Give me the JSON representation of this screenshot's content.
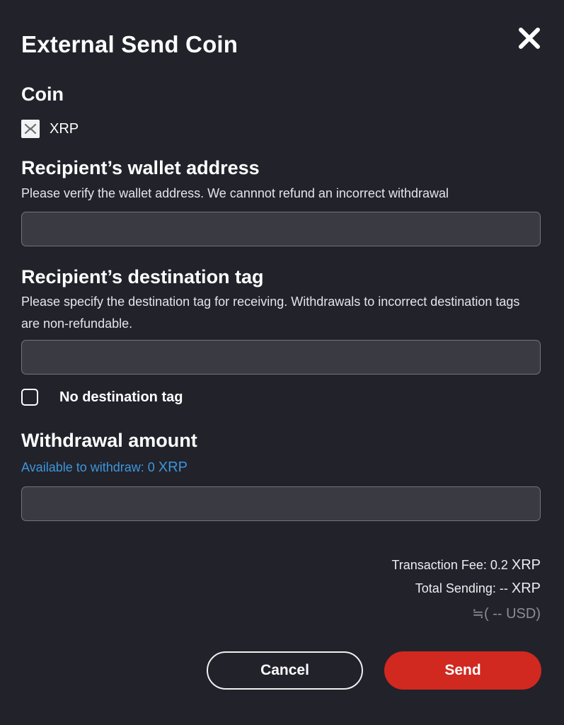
{
  "dialog": {
    "title": "External Send Coin"
  },
  "coin": {
    "label": "Coin",
    "name": "XRP",
    "icon": "xrp-icon"
  },
  "wallet": {
    "label": "Recipient’s wallet address",
    "hint": "Please verify the wallet address. We cannnot refund an incorrect withdrawal",
    "value": "",
    "placeholder": ""
  },
  "destination_tag": {
    "label": "Recipient’s destination tag",
    "hint": "Please specify the destination tag for receiving. Withdrawals to incorrect destination tags are non-refundable.",
    "value": "",
    "placeholder": "",
    "no_tag_label": "No destination tag",
    "no_tag_checked": false
  },
  "amount": {
    "label": "Withdrawal amount",
    "available_text": "Available to withdraw: 0 ",
    "available_unit": "XRP",
    "value": "",
    "placeholder": ""
  },
  "summary": {
    "fee_text": "Transaction Fee: 0.2 ",
    "fee_unit": "XRP",
    "total_text": "Total Sending: -- ",
    "total_unit": "XRP",
    "usd_text": "≒( -- USD)"
  },
  "actions": {
    "cancel_label": "Cancel",
    "send_label": "Send"
  },
  "colors": {
    "background": "#22222b",
    "field_bg": "#3a3a43",
    "accent_link": "#3b97dc",
    "send_button": "#d1281f"
  }
}
